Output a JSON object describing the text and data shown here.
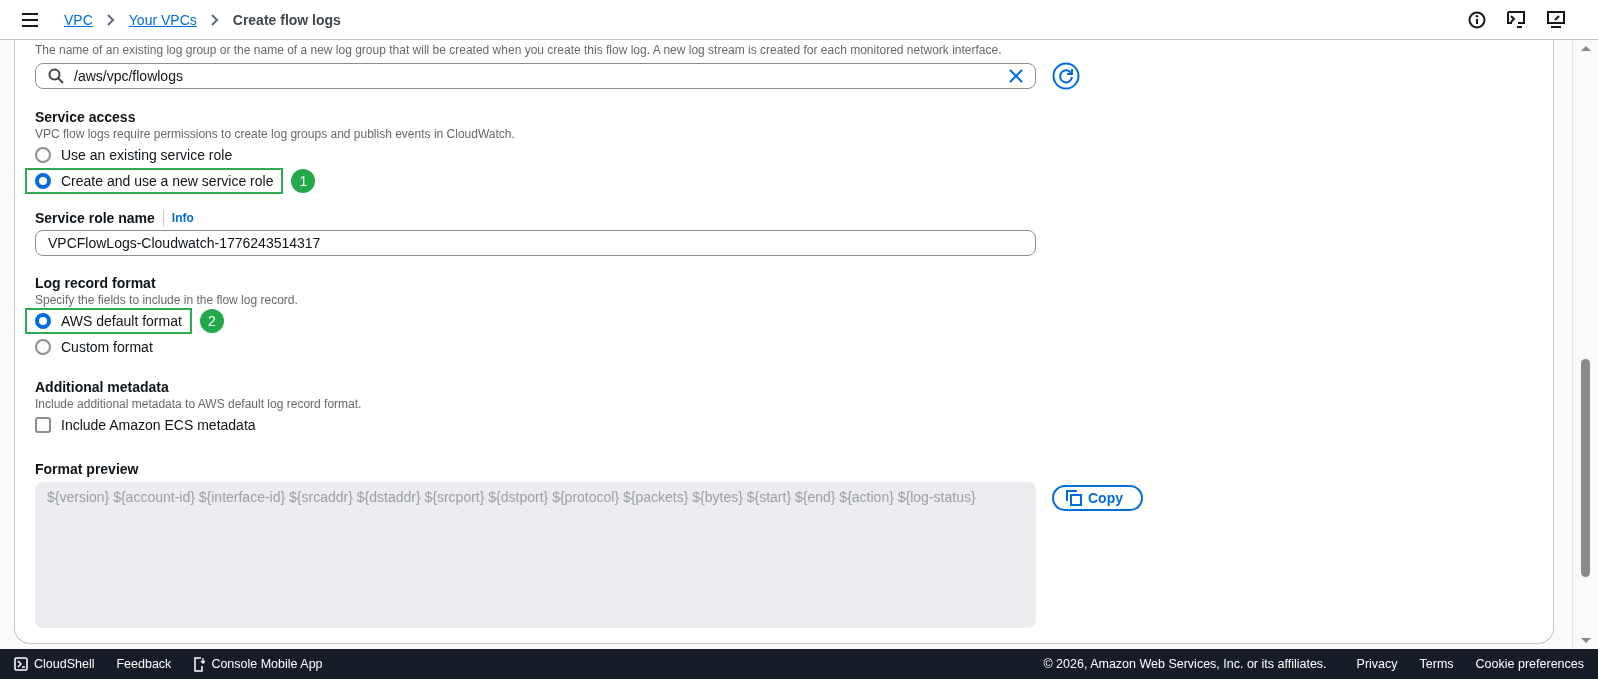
{
  "breadcrumbs": [
    {
      "label": "VPC",
      "kind": "link"
    },
    {
      "label": "Your VPCs",
      "kind": "link"
    },
    {
      "label": "Create flow logs",
      "kind": "current"
    }
  ],
  "log_group": {
    "description": "The name of an existing log group or the name of a new log group that will be created when you create this flow log. A new log stream is created for each monitored network interface.",
    "value": "/aws/vpc/flowlogs"
  },
  "service_access": {
    "title": "Service access",
    "description": "VPC flow logs require permissions to create log groups and publish events in CloudWatch.",
    "options": [
      {
        "label": "Use an existing service role",
        "selected": false
      },
      {
        "label": "Create and use a new service role",
        "selected": true,
        "callout": "1"
      }
    ]
  },
  "service_role_name": {
    "label": "Service role name",
    "info": "Info",
    "value": "VPCFlowLogs-Cloudwatch-1776243514317"
  },
  "log_record_format": {
    "title": "Log record format",
    "description": "Specify the fields to include in the flow log record.",
    "options": [
      {
        "label": "AWS default format",
        "selected": true,
        "callout": "2"
      },
      {
        "label": "Custom format",
        "selected": false
      }
    ]
  },
  "additional_metadata": {
    "title": "Additional metadata",
    "description": "Include additional metadata to AWS default log record format.",
    "checkbox": {
      "label": "Include Amazon ECS metadata",
      "checked": false
    }
  },
  "format_preview": {
    "title": "Format preview",
    "value": "${version} ${account-id} ${interface-id} ${srcaddr} ${dstaddr} ${srcport} ${dstport} ${protocol} ${packets} ${bytes} ${start} ${end} ${action} ${log-status}",
    "copy": "Copy"
  },
  "footer": {
    "left": [
      "CloudShell",
      "Feedback",
      "Console Mobile App"
    ],
    "copyright": "© 2026, Amazon Web Services, Inc. or its affiliates.",
    "right": [
      "Privacy",
      "Terms",
      "Cookie preferences"
    ]
  }
}
